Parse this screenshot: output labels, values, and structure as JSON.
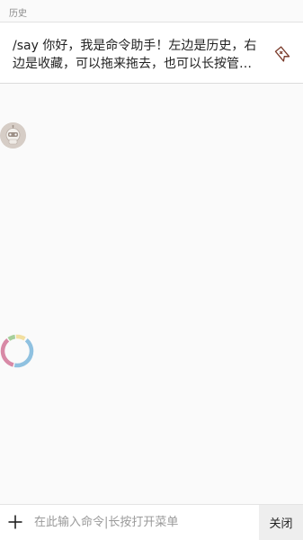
{
  "header": {
    "title": "历史"
  },
  "history": {
    "items": [
      {
        "text": "/say 你好，我是命令助手！左边是历史，右边是收藏，可以拖来拖去，也可以长按管理哦。",
        "action_icon": "bookmark-add-icon"
      }
    ]
  },
  "floating": {
    "avatar_icon": "robot-avatar-icon",
    "loader_colors": [
      "#8fc1e0",
      "#d889a6",
      "#a6cf9b",
      "#f2dfa0"
    ]
  },
  "bottom_bar": {
    "add_icon": "plus-icon",
    "input_placeholder": "在此输入命令|长按打开菜单",
    "input_value": "",
    "close_label": "关闭"
  }
}
